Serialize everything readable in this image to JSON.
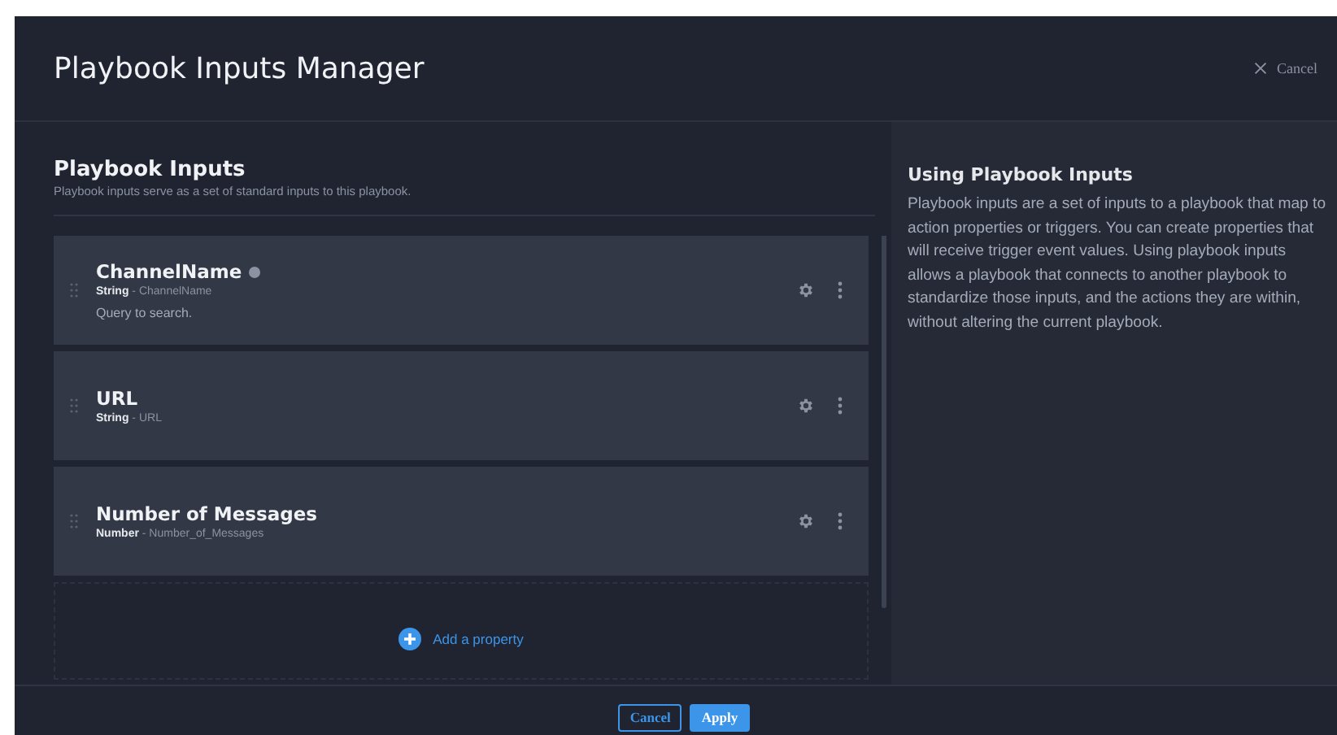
{
  "dialog": {
    "title": "Playbook Inputs Manager",
    "close_label": "Cancel"
  },
  "inputs_panel": {
    "title": "Playbook Inputs",
    "description": "Playbook inputs serve as a set of standard inputs to this playbook.",
    "inputs": [
      {
        "name": "ChannelName",
        "has_info": true,
        "meta": "**String** - ChannelName",
        "description": "Query to search."
      },
      {
        "name": "URL",
        "has_info": false,
        "meta": "**String** - URL"
      },
      {
        "name": "Number of Messages",
        "has_info": false,
        "meta": "**Number** - Number_of_Messages"
      }
    ],
    "add_label": "Add a property"
  },
  "help": {
    "title": "Using Playbook Inputs",
    "body": "Playbook inputs are a set of inputs to a playbook that map to action properties or triggers. You can create properties that will receive trigger event values. Using playbook inputs allows a playbook that connects to another playbook to standardize those inputs, and the actions they are within, without altering the current playbook."
  },
  "footer": {
    "buttons": [
      {
        "label": "Cancel",
        "kind": "secondary"
      },
      {
        "label": "Apply",
        "kind": "primary"
      }
    ]
  }
}
